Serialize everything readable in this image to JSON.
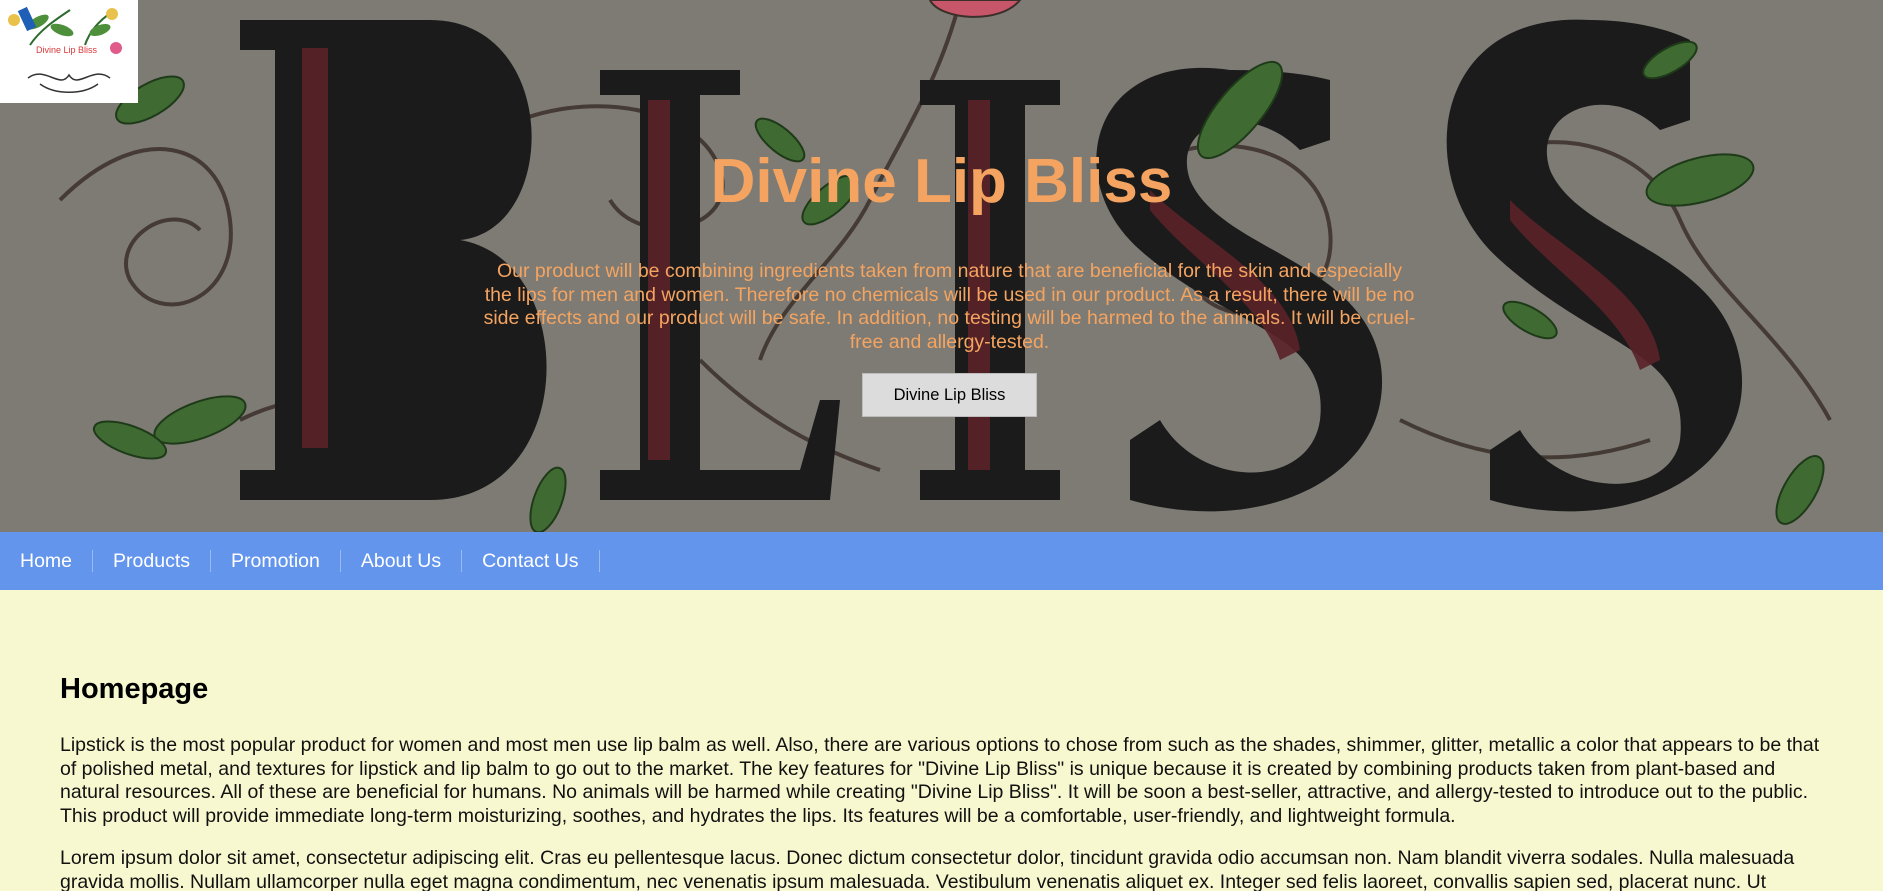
{
  "hero": {
    "title": "Divine Lip Bliss",
    "description": "Our product will be combining ingredients taken from nature that are beneficial for the skin and especially the lips for men and women. Therefore no chemicals will be used in our product. As a result, there will be no side effects and our product will be safe. In addition, no testing will be harmed to the animals. It will be cruel-free and allergy-tested.",
    "button_label": "Divine Lip Bliss",
    "background_text": "BLISS"
  },
  "logo": {
    "text": "Divine Lip Bliss"
  },
  "nav": {
    "items": [
      {
        "label": "Home"
      },
      {
        "label": "Products"
      },
      {
        "label": "Promotion"
      },
      {
        "label": "About Us"
      },
      {
        "label": "Contact Us"
      }
    ]
  },
  "main": {
    "heading": "Homepage",
    "paragraphs": [
      "Lipstick is the most popular product for women and most men use lip balm as well. Also, there are various options to chose from such as the shades, shimmer, glitter, metallic a color that appears to be that of polished metal, and textures for lipstick and lip balm to go out to the market. The key features for \"Divine Lip Bliss\" is unique because it is created by combining products taken from plant-based and natural resources. All of these are beneficial for humans. No animals will be harmed while creating \"Divine Lip Bliss\". It will be soon a best-seller, attractive, and allergy-tested to introduce out to the public. This product will provide immediate long-term moisturizing, soothes, and hydrates the lips. Its features will be a comfortable, user-friendly, and lightweight formula.",
      "Lorem ipsum dolor sit amet, consectetur adipiscing elit. Cras eu pellentesque lacus. Donec dictum consectetur dolor, tincidunt gravida odio accumsan non. Nam blandit viverra sodales. Nulla malesuada gravida mollis. Nullam ullamcorper nulla eget magna condimentum, nec venenatis ipsum malesuada. Vestibulum venenatis aliquet ex. Integer sed felis laoreet, convallis sapien sed, placerat nunc. Ut"
    ]
  },
  "colors": {
    "hero_text": "#f4a460",
    "nav_bg": "#6495ed",
    "page_bg": "#f8f8d0",
    "hero_bg": "#7c7a73"
  }
}
